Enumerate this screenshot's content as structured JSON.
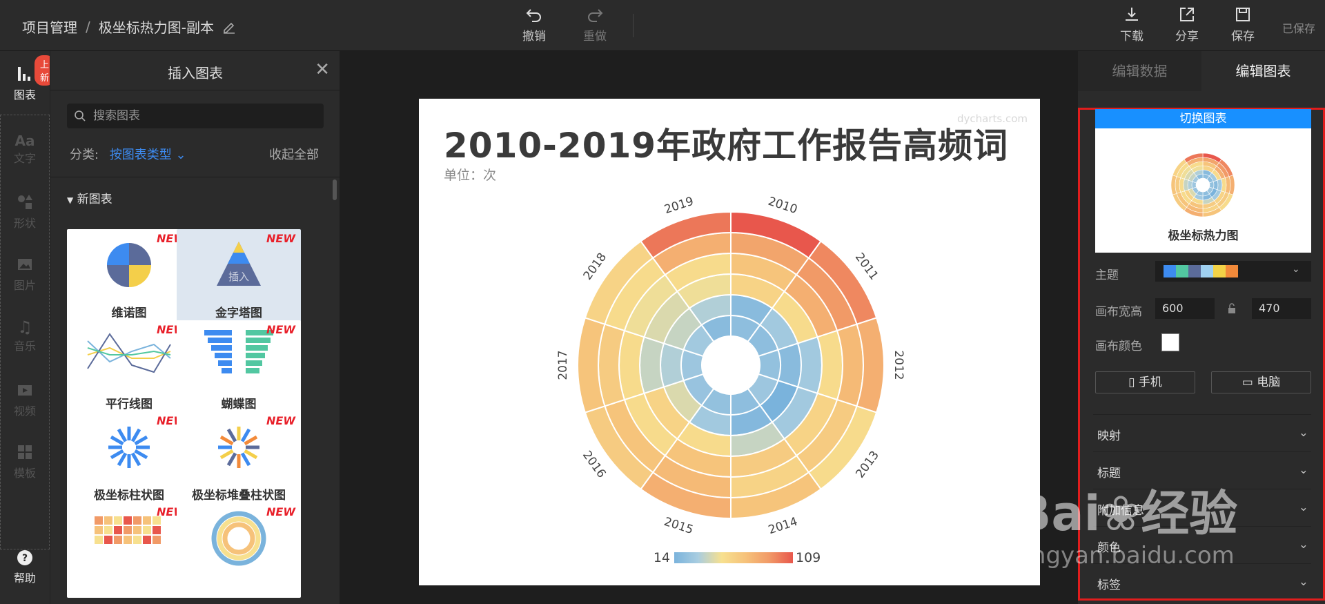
{
  "header": {
    "breadcrumb_root": "项目管理",
    "breadcrumb_sep": "/",
    "project_name": "极坐标热力图-副本",
    "undo": "撤销",
    "redo": "重做",
    "download": "下载",
    "share": "分享",
    "save": "保存",
    "saved_status": "已保存"
  },
  "rail": {
    "badge": "上新",
    "items": [
      {
        "label": "图表",
        "icon": "chart-icon"
      },
      {
        "label": "文字",
        "icon": "text-icon"
      },
      {
        "label": "形状",
        "icon": "shape-icon"
      },
      {
        "label": "图片",
        "icon": "image-icon"
      },
      {
        "label": "音乐",
        "icon": "music-icon"
      },
      {
        "label": "视频",
        "icon": "video-icon"
      },
      {
        "label": "模板",
        "icon": "template-icon"
      }
    ],
    "help": "帮助"
  },
  "panel": {
    "title": "插入图表",
    "search_placeholder": "搜索图表",
    "category_label": "分类:",
    "category_value": "按图表类型",
    "collapse_all": "收起全部",
    "group": "新图表",
    "new_tag": "NEW",
    "cards": [
      {
        "label": "维诺图"
      },
      {
        "label": "金字塔图",
        "overlay": "插入"
      },
      {
        "label": "平行线图"
      },
      {
        "label": "蝴蝶图"
      },
      {
        "label": "极坐标柱状图"
      },
      {
        "label": "极坐标堆叠柱状图"
      },
      {
        "label": ""
      },
      {
        "label": ""
      }
    ]
  },
  "chart": {
    "title": "2010-2019年政府工作报告高频词",
    "unit": "单位：次",
    "watermark": "dycharts.com",
    "legend_min": "14",
    "legend_max": "109",
    "colors": [
      "#7ab3dc",
      "#a9cde0",
      "#f7e08f",
      "#f6c27a",
      "#f19a67",
      "#e8574c"
    ]
  },
  "chart_data": {
    "type": "heatmap",
    "title": "2010-2019年政府工作报告高频词",
    "subtitle": "单位：次",
    "categories": [
      "2010",
      "2011",
      "2012",
      "2013",
      "2014",
      "2015",
      "2016",
      "2017",
      "2018",
      "2019"
    ],
    "rings": 6,
    "value_range": [
      14,
      109
    ],
    "values": [
      [
        22,
        20,
        60,
        70,
        85,
        109
      ],
      [
        22,
        30,
        55,
        80,
        90,
        95
      ],
      [
        24,
        20,
        30,
        55,
        75,
        80
      ],
      [
        28,
        14,
        30,
        60,
        65,
        55
      ],
      [
        22,
        18,
        40,
        65,
        60,
        70
      ],
      [
        24,
        30,
        55,
        70,
        75,
        80
      ],
      [
        26,
        45,
        60,
        55,
        70,
        65
      ],
      [
        28,
        35,
        40,
        55,
        65,
        70
      ],
      [
        30,
        40,
        45,
        50,
        55,
        60
      ],
      [
        20,
        35,
        50,
        55,
        80,
        100
      ]
    ]
  },
  "right": {
    "tab_data": "编辑数据",
    "tab_chart": "编辑图表",
    "switch_chart": "切换图表",
    "preview_label": "极坐标热力图",
    "theme_label": "主题",
    "theme_colors": [
      "#3d8bf0",
      "#52c7a1",
      "#5b6b9a",
      "#9fd0f0",
      "#f2d247",
      "#f28a3a"
    ],
    "canvas_size_label": "画布宽高",
    "width": "600",
    "height": "470",
    "canvas_color_label": "画布颜色",
    "mobile": "手机",
    "desktop": "电脑",
    "sections": [
      "映射",
      "标题",
      "附加信息",
      "颜色",
      "标签"
    ]
  },
  "watermark": {
    "brand": "Bai",
    "brand_cn": "经验",
    "url": "jingyan.baidu.com"
  }
}
